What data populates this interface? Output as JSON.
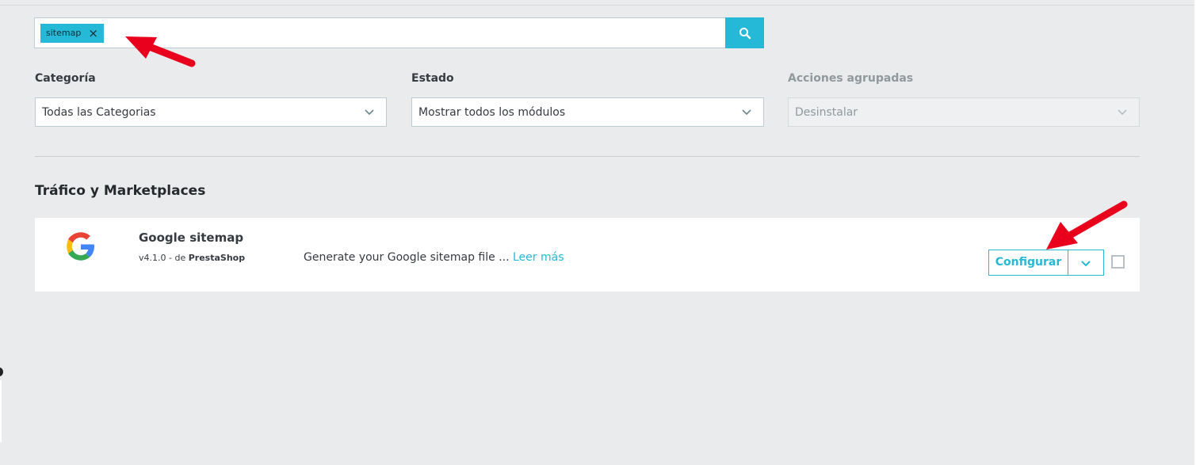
{
  "search": {
    "tag_label": "sitemap",
    "tag_remove_icon": "close-icon",
    "button_icon": "search-icon"
  },
  "filters": {
    "category": {
      "label": "Categoría",
      "selected": "Todas las Categorias"
    },
    "status": {
      "label": "Estado",
      "selected": "Mostrar todos los módulos"
    },
    "bulk": {
      "label": "Acciones agrupadas",
      "selected": "Desinstalar",
      "disabled": true
    }
  },
  "section": {
    "title": "Tráfico y Marketplaces"
  },
  "module": {
    "name": "Google sitemap",
    "version_prefix": "v4.1.0 - de ",
    "author": "PrestaShop",
    "description": "Generate your Google sitemap file ...",
    "read_more": "Leer más",
    "configure_label": "Configurar",
    "logo_icon": "google-g-icon"
  },
  "colors": {
    "accent": "#25b9d7",
    "background": "#eaebec",
    "annotation_arrow": "#e8001c"
  }
}
